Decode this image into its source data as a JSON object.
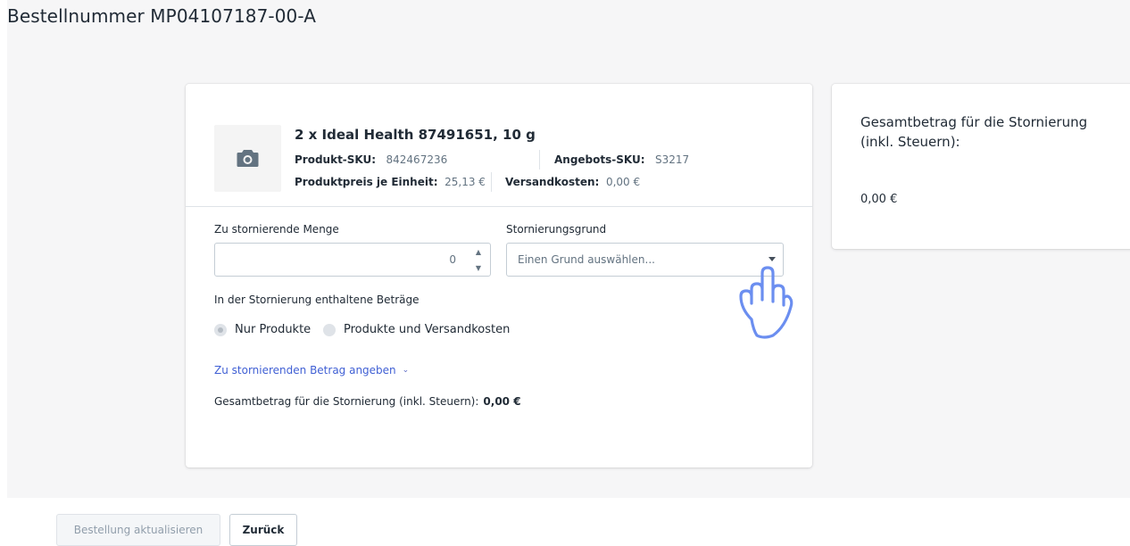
{
  "page": {
    "title": "Bestellnummer MP04107187-00-A"
  },
  "product": {
    "title": "2 x Ideal Health 87491651, 10 g",
    "sku_label": "Produkt-SKU:",
    "sku_value": "842467236",
    "offer_sku_label": "Angebots-SKU:",
    "offer_sku_value": "S3217",
    "unit_price_label": "Produktpreis je Einheit:",
    "unit_price_value": "25,13 €",
    "shipping_label": "Versandkosten:",
    "shipping_value": "0,00 €",
    "image_icon": "camera-icon"
  },
  "form": {
    "quantity_label": "Zu stornierende Menge",
    "quantity_value": "0",
    "reason_label": "Stornierungsgrund",
    "reason_placeholder": "Einen Grund auswählen...",
    "amounts_label": "In der Stornierung enthaltene Beträge",
    "radio_products_only": "Nur Produkte",
    "radio_products_shipping": "Produkte und Versandkosten",
    "selected_radio": "Nur Produkte",
    "amount_link": "Zu stornierenden Betrag angeben",
    "total_label": "Gesamtbetrag für die Stornierung (inkl. Steuern):",
    "total_value": "0,00 €"
  },
  "summary": {
    "title": "Gesamtbetrag für die Stornierung (inkl. Steuern):",
    "amount": "0,00 €"
  },
  "footer": {
    "update_label": "Bestellung aktualisieren",
    "back_label": "Zurück"
  },
  "colors": {
    "link": "#3f5fd4",
    "hand_cursor": "#6b8ef0",
    "background": "#f6f6f7"
  }
}
